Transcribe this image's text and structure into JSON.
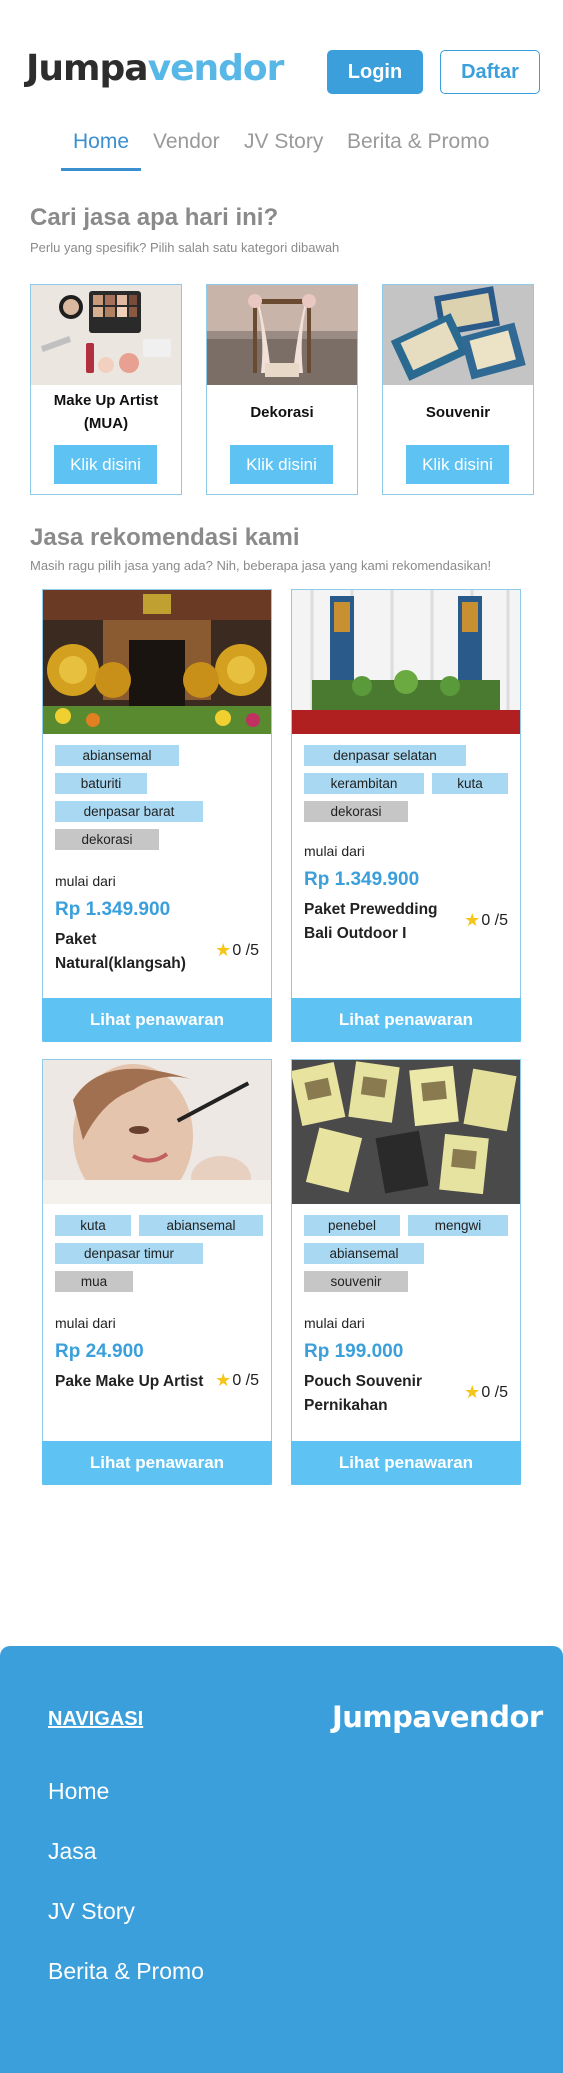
{
  "header": {
    "logo_part1": "Jumpa",
    "logo_part2": "vendor",
    "login_label": "Login",
    "daftar_label": "Daftar"
  },
  "nav": {
    "tabs": [
      {
        "label": "Home",
        "active": true
      },
      {
        "label": "Vendor",
        "active": false
      },
      {
        "label": "JV Story",
        "active": false
      },
      {
        "label": "Berita & Promo",
        "active": false
      }
    ]
  },
  "categories_section": {
    "title": "Cari jasa apa hari ini?",
    "subtitle": "Perlu yang spesifik? Pilih salah satu kategori dibawah",
    "items": [
      {
        "label_line1": "Make Up Artist",
        "label_line2": "(MUA)",
        "button": "Klik disini",
        "icon": "makeup-photo"
      },
      {
        "label_line1": "Dekorasi",
        "label_line2": "",
        "button": "Klik disini",
        "icon": "decoration-photo"
      },
      {
        "label_line1": "Souvenir",
        "label_line2": "",
        "button": "Klik disini",
        "icon": "souvenir-photo"
      }
    ]
  },
  "recommend_section": {
    "title": "Jasa rekomendasi kami",
    "subtitle": "Masih ragu pilih jasa yang ada? Nih, beberapa jasa yang kami rekomendasikan!",
    "products": [
      {
        "tags": [
          "abiansemal",
          "baturiti",
          "denpasar barat"
        ],
        "category": "dekorasi",
        "mulai": "mulai dari",
        "price": "Rp 1.349.900",
        "name_line1": "Paket",
        "name_line2": "Natural(klangsah)",
        "rating": "0 /5",
        "button": "Lihat penawaran"
      },
      {
        "tags": [
          "denpasar selatan",
          "kerambitan",
          "kuta"
        ],
        "category": "dekorasi",
        "mulai": "mulai dari",
        "price": "Rp 1.349.900",
        "name_line1": "Paket Prewedding",
        "name_line2": "Bali Outdoor I",
        "rating": "0 /5",
        "button": "Lihat penawaran"
      },
      {
        "tags": [
          "kuta",
          "abiansemal",
          "denpasar timur"
        ],
        "category": "mua",
        "mulai": "mulai dari",
        "price": "Rp 24.900",
        "name_line1": "Pake Make Up Artist",
        "name_line2": "",
        "rating": "0 /5",
        "button": "Lihat penawaran"
      },
      {
        "tags": [
          "penebel",
          "mengwi",
          "abiansemal"
        ],
        "category": "souvenir",
        "mulai": "mulai dari",
        "price": "Rp 199.000",
        "name_line1": "Pouch Souvenir",
        "name_line2": "Pernikahan",
        "rating": "0 /5",
        "button": "Lihat penawaran"
      }
    ]
  },
  "footer": {
    "nav_title": "NAVIGASI",
    "logo": "Jumpavendor",
    "links": [
      "Home",
      "Jasa",
      "JV Story",
      "Berita & Promo"
    ]
  },
  "colors": {
    "primary": "#3a9fdb",
    "button_light": "#5ec3f2",
    "tag": "#a8d8f2",
    "tag_category": "#c6c6c6",
    "star": "#f5c518"
  }
}
